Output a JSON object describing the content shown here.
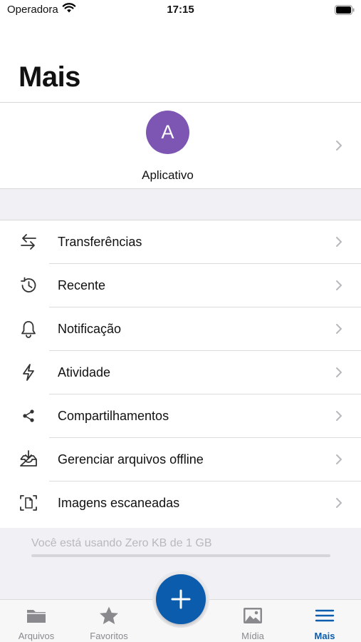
{
  "status_bar": {
    "carrier": "Operadora",
    "time": "17:15"
  },
  "page": {
    "title": "Mais"
  },
  "profile": {
    "avatar_letter": "A",
    "avatar_color": "#7d56b3",
    "name": "Aplicativo"
  },
  "menu": {
    "items": [
      {
        "label": "Transferências",
        "icon": "transfer-arrows-icon"
      },
      {
        "label": "Recente",
        "icon": "history-icon"
      },
      {
        "label": "Notificação",
        "icon": "bell-icon"
      },
      {
        "label": "Atividade",
        "icon": "lightning-icon"
      },
      {
        "label": "Compartilhamentos",
        "icon": "share-icon"
      },
      {
        "label": "Gerenciar arquivos offline",
        "icon": "offline-download-icon"
      },
      {
        "label": "Imagens escaneadas",
        "icon": "scan-document-icon"
      }
    ]
  },
  "storage": {
    "text": "Você está usando Zero KB de 1 GB",
    "used_fraction": 0
  },
  "tabbar": {
    "tabs": [
      {
        "label": "Arquivos",
        "icon": "folder-icon",
        "active": false
      },
      {
        "label": "Favoritos",
        "icon": "star-icon",
        "active": false
      },
      {
        "label": "Mídia",
        "icon": "image-icon",
        "active": false
      },
      {
        "label": "Mais",
        "icon": "menu-lines-icon",
        "active": true
      }
    ]
  },
  "colors": {
    "accent": "#0b5cad",
    "avatar": "#7d56b3",
    "background_gray": "#f1f1f5"
  },
  "fab": {
    "icon": "plus-icon"
  }
}
